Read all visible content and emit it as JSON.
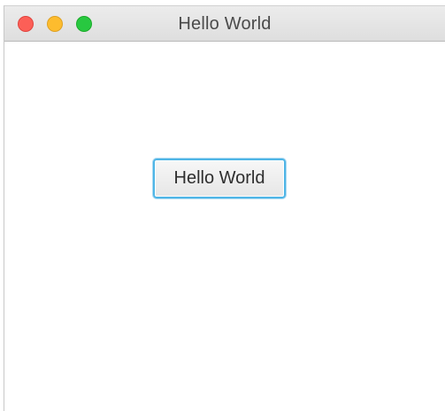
{
  "window": {
    "title": "Hello World",
    "controls": {
      "close_color": "#fc5f57",
      "minimize_color": "#fdbc2e",
      "zoom_color": "#28c840"
    }
  },
  "main": {
    "button_label": "Hello World",
    "button_focus_color": "#4fb5e6"
  }
}
